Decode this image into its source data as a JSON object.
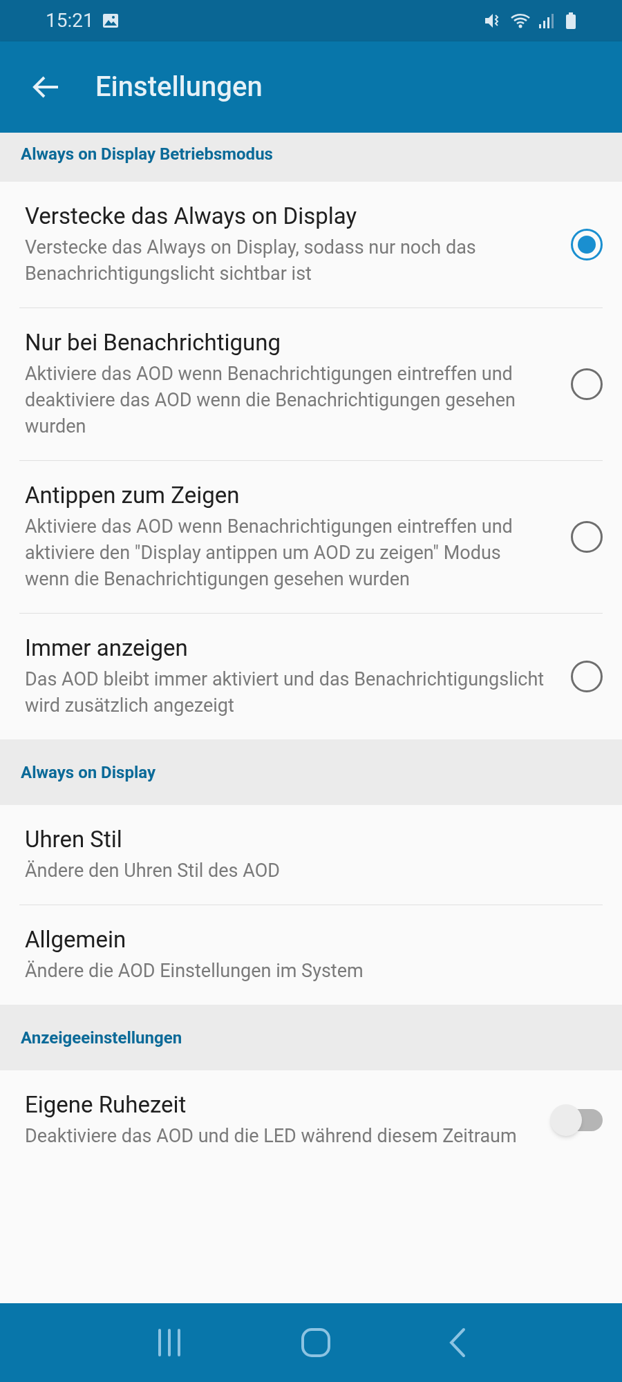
{
  "status_bar": {
    "time": "15:21"
  },
  "app_bar": {
    "title": "Einstellungen"
  },
  "sections": [
    {
      "header": "Always on Display Betriebsmodus",
      "items": [
        {
          "kind": "radio",
          "title": "Verstecke das Always on Display",
          "subtitle": "Verstecke das Always on Display, sodass nur noch das Benachrichtigungslicht sichtbar ist",
          "selected": true
        },
        {
          "kind": "radio",
          "title": "Nur bei Benachrichtigung",
          "subtitle": "Aktiviere das AOD wenn Benachrichtigungen eintreffen und deaktiviere das AOD wenn die Benachrichtigungen gesehen wurden",
          "selected": false
        },
        {
          "kind": "radio",
          "title": "Antippen zum Zeigen",
          "subtitle": "Aktiviere das AOD wenn Benachrichtigungen eintreffen und aktiviere den \"Display antippen um AOD zu zeigen\" Modus wenn die Benachrichtigungen gesehen wurden",
          "selected": false
        },
        {
          "kind": "radio",
          "title": "Immer anzeigen",
          "subtitle": "Das AOD bleibt immer aktiviert und das Benachrichtigungslicht wird zusätzlich angezeigt",
          "selected": false
        }
      ]
    },
    {
      "header": "Always on Display",
      "items": [
        {
          "kind": "link",
          "title": "Uhren Stil",
          "subtitle": "Ändere den Uhren Stil des AOD"
        },
        {
          "kind": "link",
          "title": "Allgemein",
          "subtitle": "Ändere die AOD Einstellungen im System"
        }
      ]
    },
    {
      "header": "Anzeigeeinstellungen",
      "items": [
        {
          "kind": "switch",
          "title": "Eigene Ruhezeit",
          "subtitle": "Deaktiviere das AOD und die LED während diesem Zeitraum",
          "on": false
        }
      ]
    }
  ]
}
